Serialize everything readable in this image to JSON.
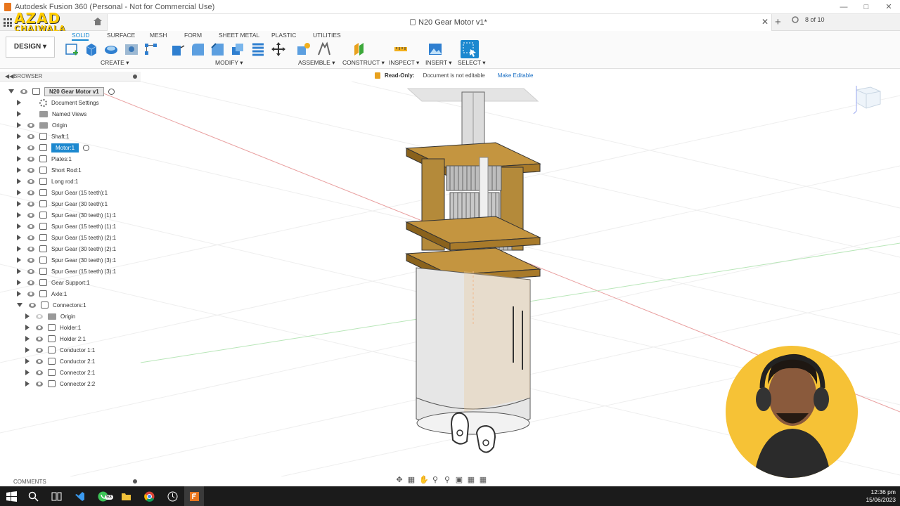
{
  "window": {
    "title": "Autodesk Fusion 360 (Personal - Not for Commercial Use)"
  },
  "tabbar": {
    "document_tab": "N20 Gear Motor v1*",
    "job_count": "8 of 10"
  },
  "watermark": {
    "line1": "AZAD",
    "line2": "CHAIWALA"
  },
  "ribbon": {
    "workspace": "DESIGN",
    "tabs": [
      "SOLID",
      "SURFACE",
      "MESH",
      "FORM",
      "SHEET METAL",
      "PLASTIC",
      "UTILITIES"
    ],
    "groups": [
      "CREATE",
      "MODIFY",
      "ASSEMBLE",
      "CONSTRUCT",
      "INSPECT",
      "INSERT",
      "SELECT"
    ]
  },
  "browser": {
    "title": "BROWSER",
    "root": "N20 Gear Motor v1",
    "items": [
      {
        "label": "Document Settings",
        "icon": "gear-icon"
      },
      {
        "label": "Named Views",
        "icon": "folder-icon"
      },
      {
        "label": "Origin",
        "icon": "folder-icon"
      },
      {
        "label": "Shaft:1",
        "icon": "component-icon"
      },
      {
        "label": "Motor:1",
        "icon": "component-icon",
        "selected": true
      },
      {
        "label": "Plates:1",
        "icon": "component-icon"
      },
      {
        "label": "Short Rod:1",
        "icon": "component-icon"
      },
      {
        "label": "Long rod:1",
        "icon": "component-icon"
      },
      {
        "label": "Spur Gear (15 teeth):1",
        "icon": "component-icon"
      },
      {
        "label": "Spur Gear (30 teeth):1",
        "icon": "component-icon"
      },
      {
        "label": "Spur Gear (30 teeth) (1):1",
        "icon": "component-icon"
      },
      {
        "label": "Spur Gear (15 teeth) (1):1",
        "icon": "component-icon"
      },
      {
        "label": "Spur Gear (15 teeth) (2):1",
        "icon": "component-icon"
      },
      {
        "label": "Spur Gear (30 teeth) (2):1",
        "icon": "component-icon"
      },
      {
        "label": "Spur Gear (30 teeth) (3):1",
        "icon": "component-icon"
      },
      {
        "label": "Spur Gear (15 teeth) (3):1",
        "icon": "component-icon"
      },
      {
        "label": "Gear Support:1",
        "icon": "component-icon"
      },
      {
        "label": "Axle:1",
        "icon": "component-icon"
      },
      {
        "label": "Connectors:1",
        "icon": "component-icon",
        "expanded": true
      },
      {
        "label": "Origin",
        "icon": "folder-icon",
        "child": true
      },
      {
        "label": "Holder:1",
        "icon": "component-icon",
        "child": true
      },
      {
        "label": "Holder 2:1",
        "icon": "component-icon",
        "child": true
      },
      {
        "label": "Conductor 1:1",
        "icon": "component-icon",
        "child": true
      },
      {
        "label": "Conductor 2:1",
        "icon": "component-icon",
        "child": true
      },
      {
        "label": "Connector 2:1",
        "icon": "component-icon",
        "child": true
      },
      {
        "label": "Connector 2:2",
        "icon": "component-icon",
        "child": true
      }
    ]
  },
  "readonly_bar": {
    "label": "Read-Only:",
    "message": "Document is not editable",
    "action": "Make Editable"
  },
  "comments": {
    "title": "COMMENTS"
  },
  "taskbar": {
    "whatsapp_badge": "93",
    "time": "12:36 pm",
    "date": "15/06/2023"
  },
  "colors": {
    "accent": "#1c88cf",
    "plate": "#a87a2a",
    "fusion_orange": "#e8761e"
  }
}
